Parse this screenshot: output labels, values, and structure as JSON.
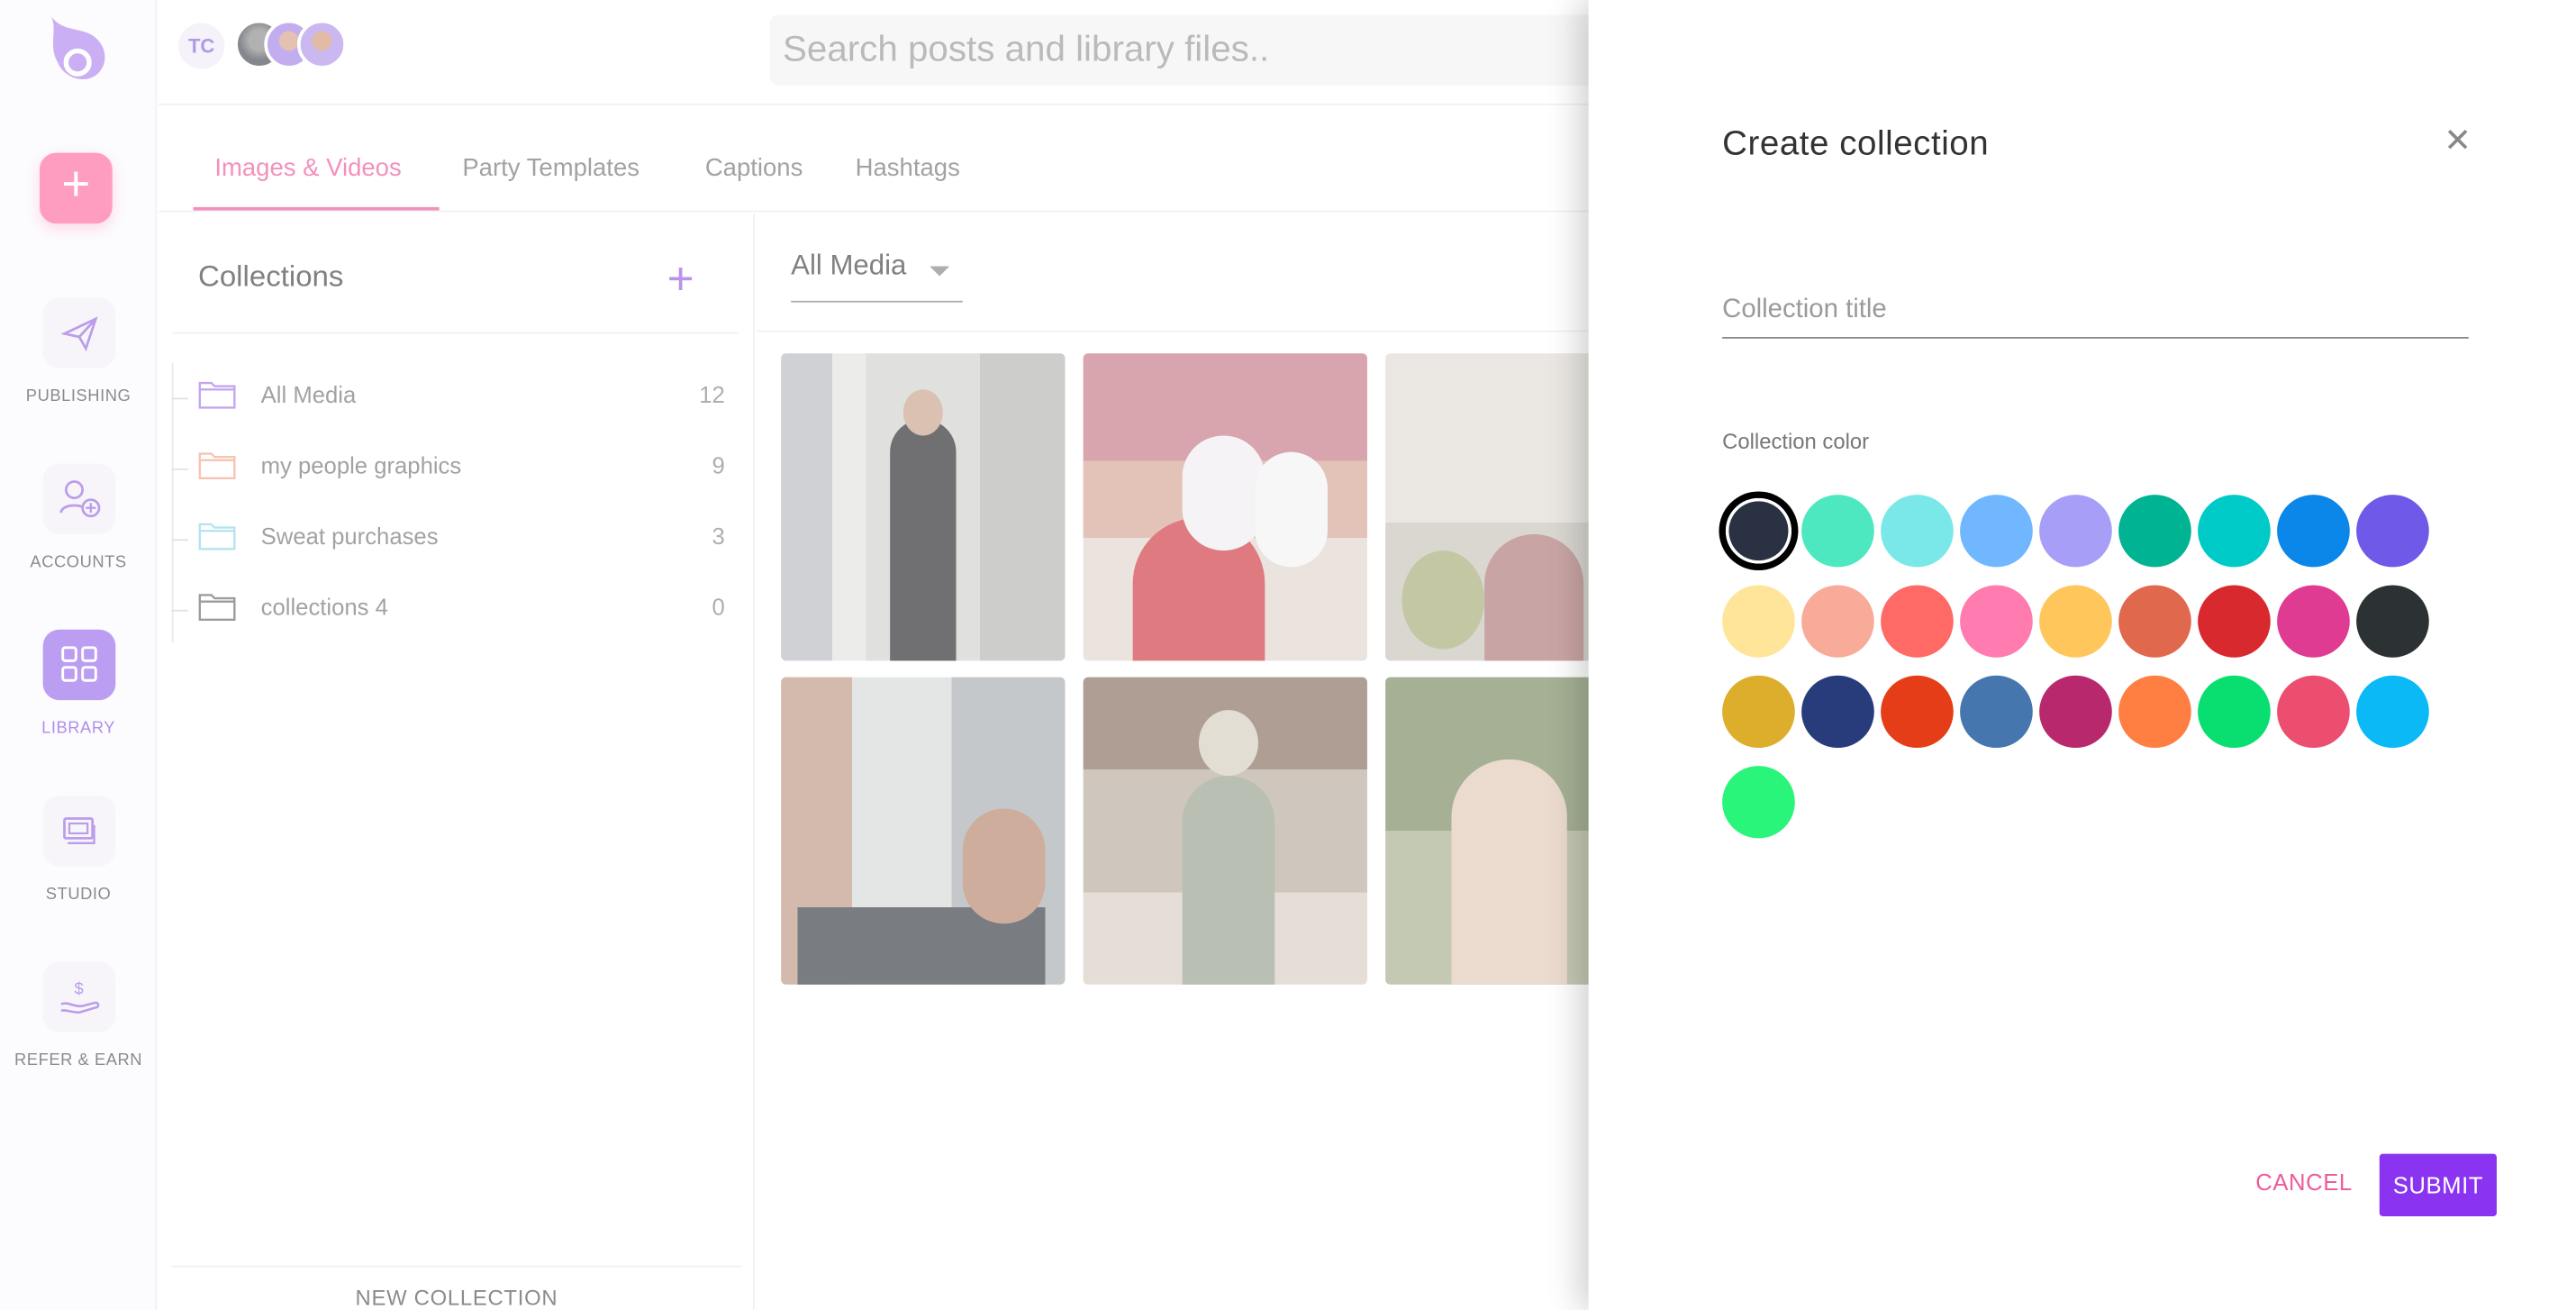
{
  "topbar": {
    "user_initials": "TC",
    "search_placeholder": "Search posts and library files.."
  },
  "sidebar": {
    "items": [
      {
        "label": "PUBLISHING",
        "icon": "paper-plane-icon"
      },
      {
        "label": "ACCOUNTS",
        "icon": "add-user-icon"
      },
      {
        "label": "LIBRARY",
        "icon": "grid-icon"
      },
      {
        "label": "STUDIO",
        "icon": "layers-icon"
      },
      {
        "label": "REFER & EARN",
        "icon": "hand-dollar-icon"
      }
    ]
  },
  "tabs": [
    "Images & Videos",
    "Party Templates",
    "Captions",
    "Hashtags"
  ],
  "collections": {
    "title": "Collections",
    "items": [
      {
        "name": "All Media",
        "count": "12",
        "color": "#a87be8"
      },
      {
        "name": "my people graphics",
        "count": "9",
        "color": "#f3a98e"
      },
      {
        "name": "Sweat purchases",
        "count": "3",
        "color": "#8fd8e8"
      },
      {
        "name": "collections 4",
        "count": "0",
        "color": "#6e6e6e"
      }
    ],
    "new_button": "NEW COLLECTION"
  },
  "media": {
    "filter_value": "All Media"
  },
  "drawer": {
    "title": "Create collection",
    "input_placeholder": "Collection title",
    "color_label": "Collection color",
    "cancel": "CANCEL",
    "submit": "SUBMIT",
    "swatches": [
      "#2a3142",
      "#4de8bf",
      "#7ae8e8",
      "#70b7ff",
      "#a79ef8",
      "#00b393",
      "#00cac8",
      "#0a87e8",
      "#6e59e8",
      "#ffe59a",
      "#f8ab98",
      "#ff6a66",
      "#ff7bb0",
      "#ffc65c",
      "#e0684c",
      "#d82a2e",
      "#e03b92",
      "#2c3233",
      "#ddae2b",
      "#283c7c",
      "#e53d17",
      "#4577ae",
      "#b8286c",
      "#ff7e42",
      "#09de70",
      "#ec4e6f",
      "#0ab9f5",
      "#28f57a"
    ]
  }
}
